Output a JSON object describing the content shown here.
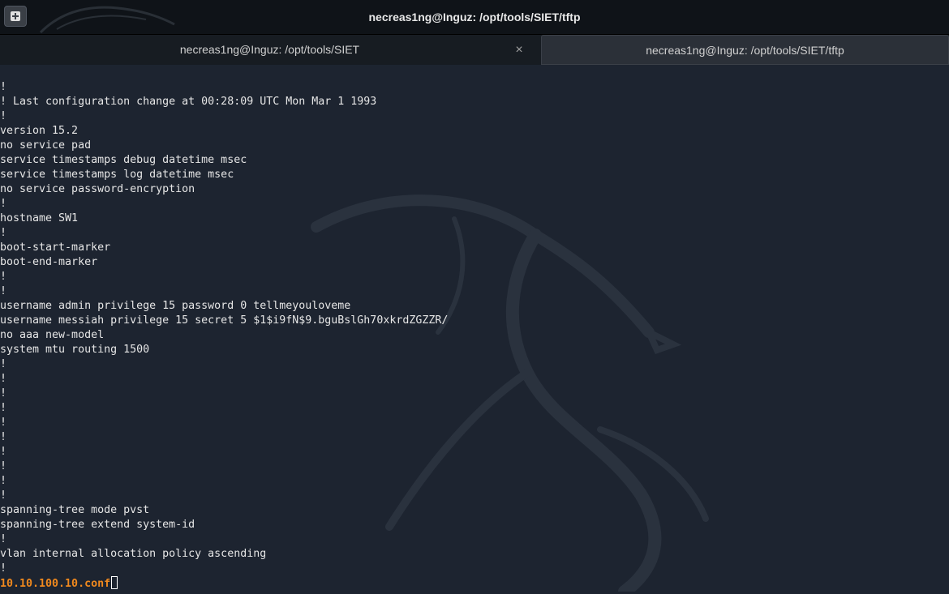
{
  "window": {
    "title": "necreas1ng@Inguz: /opt/tools/SIET/tftp"
  },
  "toolbar": {
    "new_tab_icon": "new-tab-icon"
  },
  "tabs": [
    {
      "label": "necreas1ng@Inguz: /opt/tools/SIET",
      "close": "×",
      "active": false
    },
    {
      "label": "necreas1ng@Inguz: /opt/tools/SIET/tftp",
      "active": true
    }
  ],
  "terminal": {
    "lines": [
      "!",
      "! Last configuration change at 00:28:09 UTC Mon Mar 1 1993",
      "!",
      "version 15.2",
      "no service pad",
      "service timestamps debug datetime msec",
      "service timestamps log datetime msec",
      "no service password-encryption",
      "!",
      "hostname SW1",
      "!",
      "boot-start-marker",
      "boot-end-marker",
      "!",
      "!",
      "username admin privilege 15 password 0 tellmeyouloveme",
      "username messiah privilege 15 secret 5 $1$i9fN$9.bguBslGh70xkrdZGZZR/",
      "no aaa new-model",
      "system mtu routing 1500",
      "!",
      "!",
      "!",
      "!",
      "!",
      "!",
      "!",
      "!",
      "!",
      "!",
      "spanning-tree mode pvst",
      "spanning-tree extend system-id",
      "!",
      "vlan internal allocation policy ascending",
      "!"
    ],
    "prompt_text": "10.10.100.10.conf",
    "prompt_color": "#f0891e",
    "text_color": "#e6e6e6",
    "background_color": "#1d2430"
  }
}
